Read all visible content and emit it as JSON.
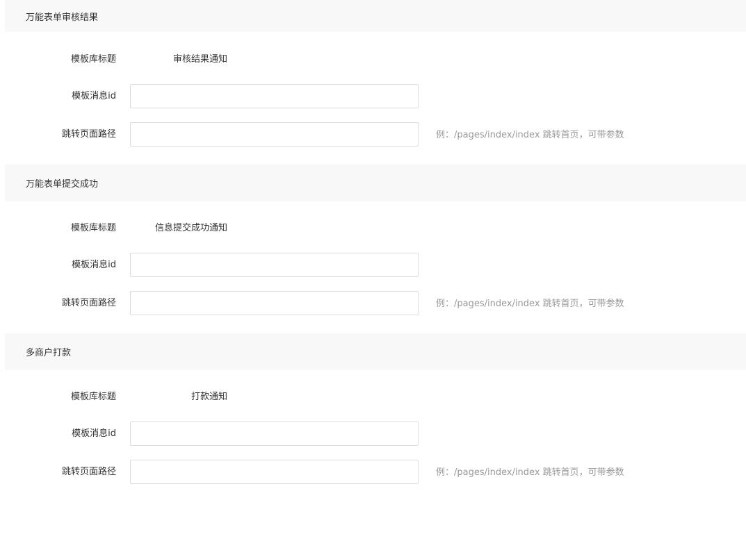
{
  "sections": [
    {
      "title": "万能表单审核结果",
      "template_title_label": "模板库标题",
      "template_title_value": "审核结果通知",
      "template_id_label": "模板消息id",
      "template_id_value": "",
      "page_path_label": "跳转页面路径",
      "page_path_value": "",
      "page_path_hint": "例：/pages/index/index 跳转首页，可带参数"
    },
    {
      "title": "万能表单提交成功",
      "template_title_label": "模板库标题",
      "template_title_value": "信息提交成功通知",
      "template_id_label": "模板消息id",
      "template_id_value": "",
      "page_path_label": "跳转页面路径",
      "page_path_value": "",
      "page_path_hint": "例：/pages/index/index 跳转首页，可带参数"
    },
    {
      "title": "多商户打款",
      "template_title_label": "模板库标题",
      "template_title_value": "打款通知",
      "template_id_label": "模板消息id",
      "template_id_value": "",
      "page_path_label": "跳转页面路径",
      "page_path_value": "",
      "page_path_hint": "例：/pages/index/index 跳转首页，可带参数"
    }
  ],
  "colors": {
    "header_bg": "#f8f8f8",
    "text": "#333333",
    "hint": "#999999",
    "input_border": "#dcdcdc"
  }
}
